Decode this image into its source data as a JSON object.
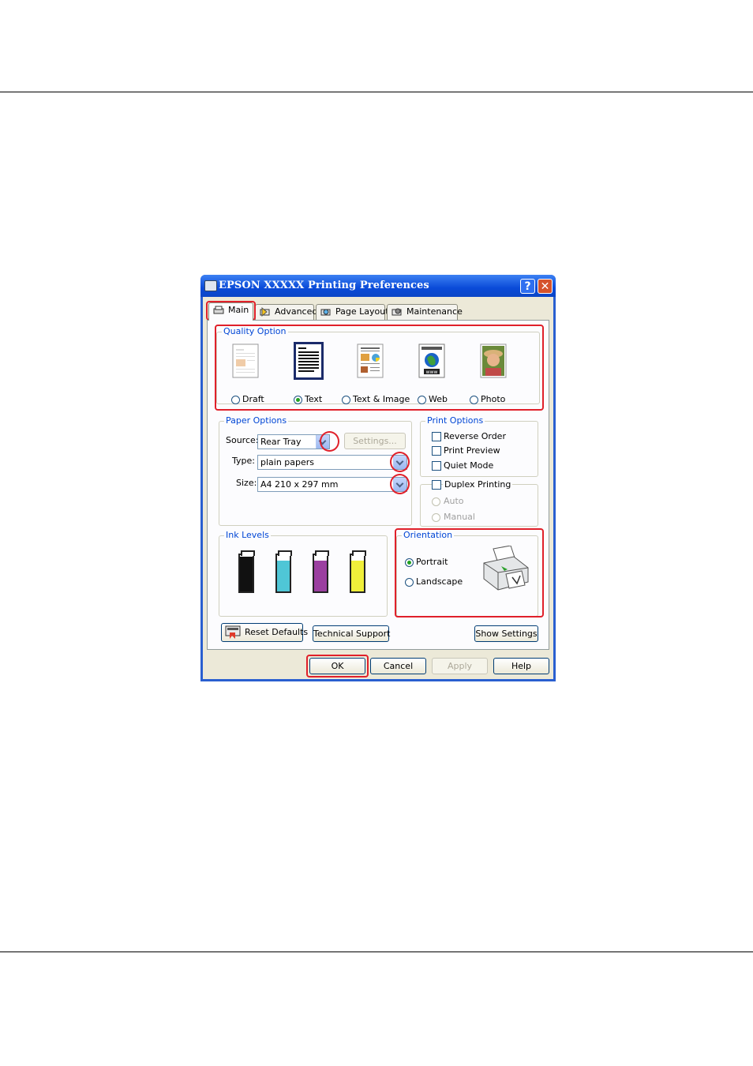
{
  "window": {
    "title": "EPSON  XXXXX  Printing Preferences",
    "help_glyph": "?",
    "close_glyph": "✕"
  },
  "tabs": [
    {
      "label": "Main",
      "icon": "printer-icon"
    },
    {
      "label": "Advanced",
      "icon": "advanced-icon"
    },
    {
      "label": "Page Layout",
      "icon": "page-layout-icon"
    },
    {
      "label": "Maintenance",
      "icon": "maintenance-icon"
    }
  ],
  "quality_option": {
    "label": "Quality Option",
    "options": [
      "Draft",
      "Text",
      "Text & Image",
      "Web",
      "Photo"
    ],
    "selected": "Text"
  },
  "paper_options": {
    "label": "Paper Options",
    "source_label": "Source:",
    "source_value": "Rear Tray",
    "settings_button": "Settings...",
    "type_label": "Type:",
    "type_value": "plain papers",
    "size_label": "Size:",
    "size_value": "A4 210 x 297 mm"
  },
  "print_options": {
    "label": "Print Options",
    "reverse_order": "Reverse Order",
    "print_preview": "Print Preview",
    "quiet_mode": "Quiet Mode"
  },
  "duplex": {
    "label": "Duplex Printing",
    "auto": "Auto",
    "manual": "Manual"
  },
  "ink_levels": {
    "label": "Ink Levels",
    "cartridges": [
      {
        "color": "#111111",
        "level": 0.95
      },
      {
        "color": "#4fc6d6",
        "level": 0.85
      },
      {
        "color": "#9b3fa0",
        "level": 0.85
      },
      {
        "color": "#f0ef3a",
        "level": 0.85
      }
    ]
  },
  "orientation": {
    "label": "Orientation",
    "portrait": "Portrait",
    "landscape": "Landscape",
    "selected": "Portrait"
  },
  "buttons": {
    "reset_defaults": "Reset Defaults",
    "technical_support": "Technical Support",
    "show_settings": "Show Settings",
    "ok": "OK",
    "cancel": "Cancel",
    "apply": "Apply",
    "help": "Help"
  },
  "colors": {
    "highlight": "#e0202a",
    "titlebar": "#0a4ad8",
    "group_label": "#0046d5"
  }
}
